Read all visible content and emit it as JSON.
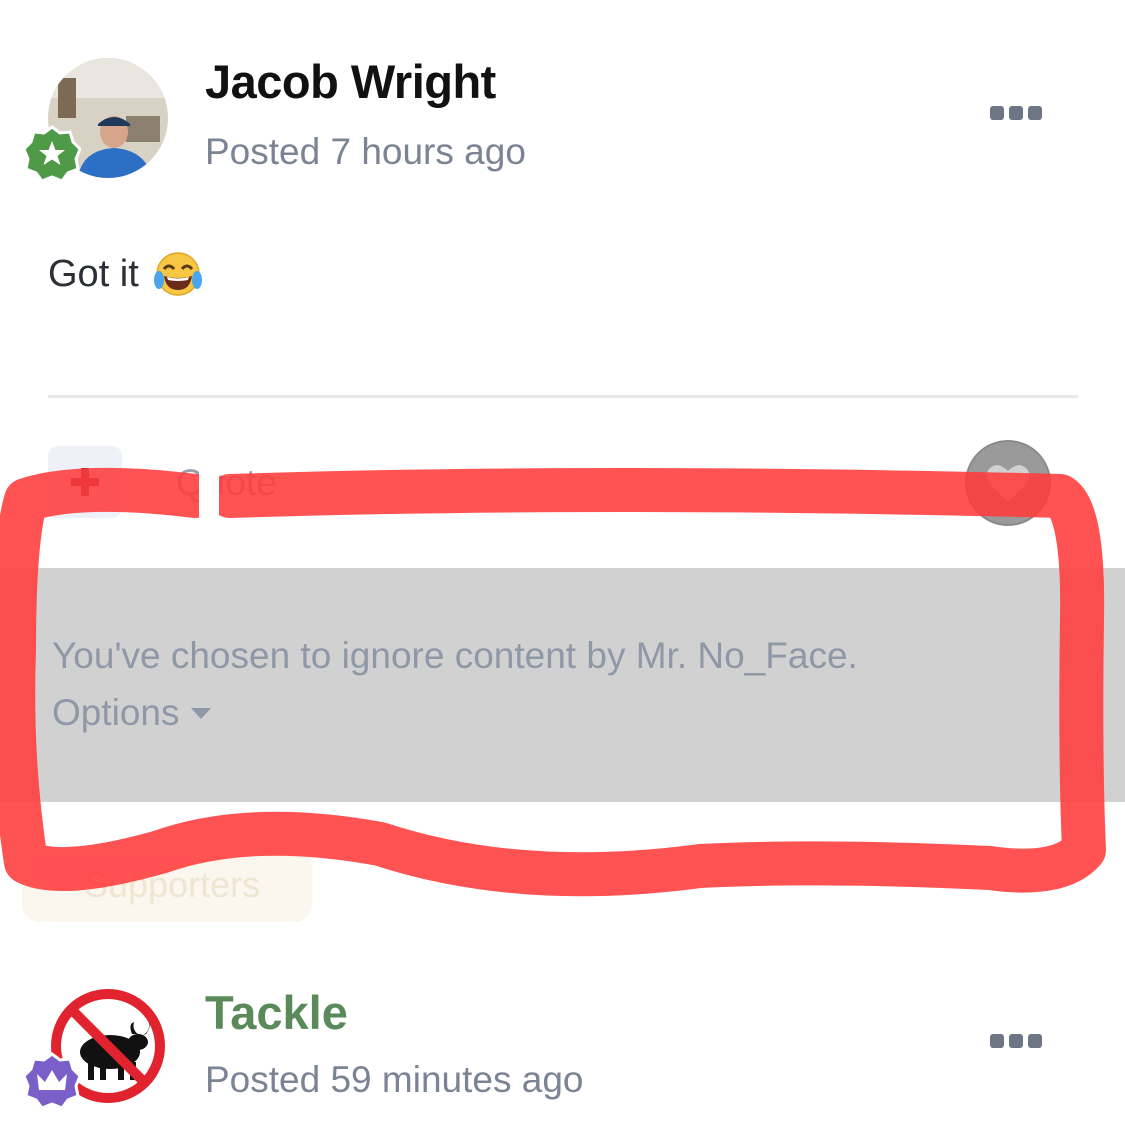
{
  "posts": [
    {
      "author": "Jacob Wright",
      "posted": "Posted 7 hours ago",
      "body": "Got it",
      "body_emoji": "face-with-tears-of-joy",
      "badge_color": "#4e9a46",
      "badge_icon": "star-icon"
    },
    {
      "author": "Tackle",
      "posted": "Posted 59 minutes ago",
      "author_color": "#5b8a5a",
      "badge_color": "#7b5fc9",
      "badge_icon": "crown-icon"
    }
  ],
  "actions": {
    "add_icon": "plus-icon",
    "quote_label": "Quote",
    "like_icon": "heart-icon"
  },
  "ignored": {
    "message": "You've chosen to ignore content by Mr. No_Face.",
    "options_label": "Options"
  },
  "supporters_label": "Supporters",
  "annotation_color": "#ff3b3b"
}
